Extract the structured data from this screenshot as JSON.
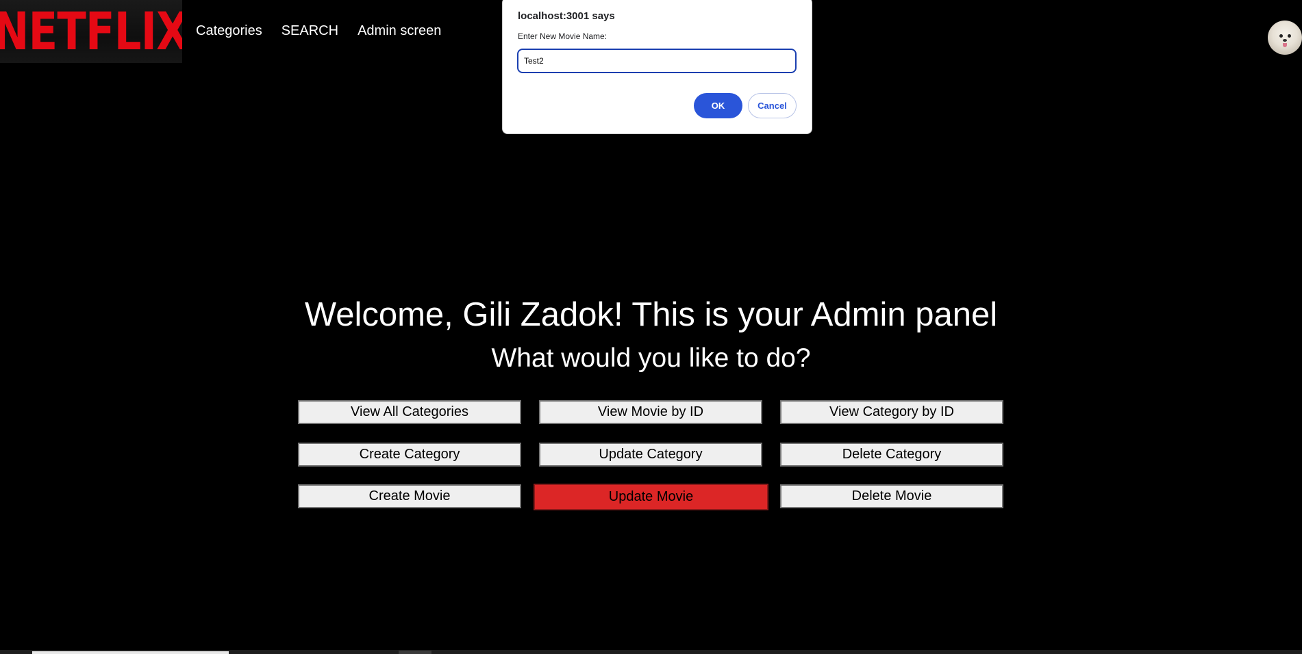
{
  "header": {
    "logo_text": "NETFLIX",
    "nav": [
      {
        "label": "Categories"
      },
      {
        "label": "SEARCH"
      },
      {
        "label": "Admin screen"
      }
    ],
    "avatar_icon": "user-avatar-dog"
  },
  "main": {
    "welcome": "Welcome, Gili Zadok! This is your Admin panel",
    "subtitle": "What would you like to do?",
    "buttons": [
      {
        "label": "View All Categories"
      },
      {
        "label": "View Movie by ID"
      },
      {
        "label": "View Category by ID"
      },
      {
        "label": "Create Category"
      },
      {
        "label": "Update Category"
      },
      {
        "label": "Delete Category"
      },
      {
        "label": "Create Movie"
      },
      {
        "label": "Update Movie"
      },
      {
        "label": "Delete Movie"
      }
    ],
    "active_button": "Update Movie"
  },
  "dialog": {
    "title": "localhost:3001 says",
    "message": "Enter New Movie Name:",
    "input_value": "Test2",
    "ok_label": "OK",
    "cancel_label": "Cancel"
  },
  "colors": {
    "brand": "#e50914",
    "active_button": "#dc2626",
    "dialog_primary": "#2a55d9",
    "background": "#000000"
  }
}
